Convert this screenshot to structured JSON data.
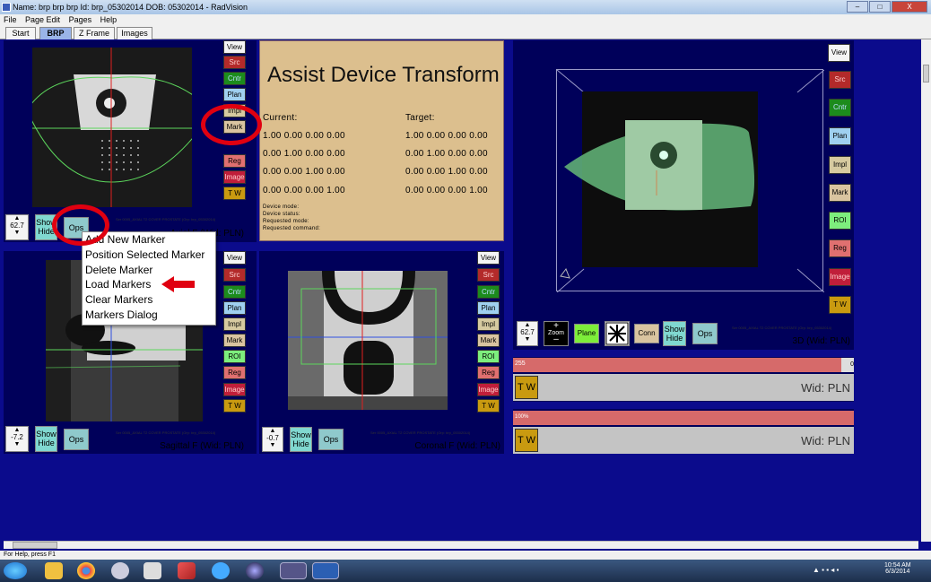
{
  "window": {
    "title": "Name: brp brp brp    Id: brp_05302014    DOB: 05302014 - RadVision",
    "buttons": [
      "–",
      "□",
      "X"
    ]
  },
  "menu": [
    "File",
    "Page Edit",
    "Pages",
    "Help"
  ],
  "tabs": [
    "Start",
    "BRP",
    "Z Frame",
    "Images"
  ],
  "side_buttons": {
    "view": "View",
    "src": "Src",
    "cntr": "Cntr",
    "plan": "Plan",
    "impl": "Impl",
    "mark": "Mark",
    "roi": "ROI",
    "reg": "Reg",
    "image": "Image",
    "tw": "T W"
  },
  "axial": {
    "stepper": "62.7",
    "show": "Show",
    "hide": "Hide",
    "ops": "Ops",
    "caption": "Axial F (Wid: PLN)",
    "series": "Ser 0005_AXIAL T2 COVER PROSTATE (Orp: brp_05302014)"
  },
  "sagittal": {
    "stepper": "-7.2",
    "show": "Show",
    "hide": "Hide",
    "ops": "Ops",
    "caption": "Sagittal F (Wid: PLN)",
    "series": "Ser 0005_AXIAL T2 COVER PROSTATE (Orp: brp_05302014)"
  },
  "coronal": {
    "stepper": "-0.7",
    "show": "Show",
    "hide": "Hide",
    "ops": "Ops",
    "caption": "Coronal F (Wid: PLN)",
    "series": "Ser 0005_AXIAL T2 COVER PROSTATE (Orp: brp_05302014)"
  },
  "view3d": {
    "stepper": "62.7",
    "zoom": "Zoom",
    "plane": "Plane",
    "conn": "Conn",
    "show": "Show",
    "hide": "Hide",
    "ops": "Ops",
    "caption": "3D (Wid: PLN)",
    "series": "Ser 0005_AXIAL T2 COVER PROSTATE (Orp: brp_05302014)"
  },
  "assist": {
    "title": "Assist Device Transform",
    "current_label": "Current:",
    "target_label": "Target:",
    "current_rows": [
      "1.00  0.00  0.00  0.00",
      "0.00  1.00  0.00  0.00",
      "0.00  0.00  1.00  0.00",
      "0.00  0.00  0.00  1.00"
    ],
    "target_rows": [
      "1.00  0.00  0.00  0.00",
      "0.00  1.00  0.00  0.00",
      "0.00  0.00  1.00  0.00",
      "0.00  0.00  0.00  1.00"
    ],
    "status": [
      "Device mode:",
      "Device status:",
      "Requested mode:",
      "Requested command:"
    ]
  },
  "context_menu": [
    "Add New Marker",
    "Position Selected Marker",
    "Delete Marker",
    "Load Markers",
    "Clear Markers",
    "Markers Dialog"
  ],
  "window_level_1": {
    "left_value": "255",
    "right_value": "0",
    "tw": "T W",
    "label": "Wid: PLN"
  },
  "window_level_2": {
    "left_value": "100%",
    "tw": "T W",
    "label": "Wid: PLN"
  },
  "statusbar": "For Help, press F1",
  "clock": {
    "time": "10:54 AM",
    "date": "6/3/2014"
  },
  "colors": {
    "background": "#0b0b8c",
    "panel_tan": "#dcbf8e",
    "annotation_red": "#e00010"
  }
}
